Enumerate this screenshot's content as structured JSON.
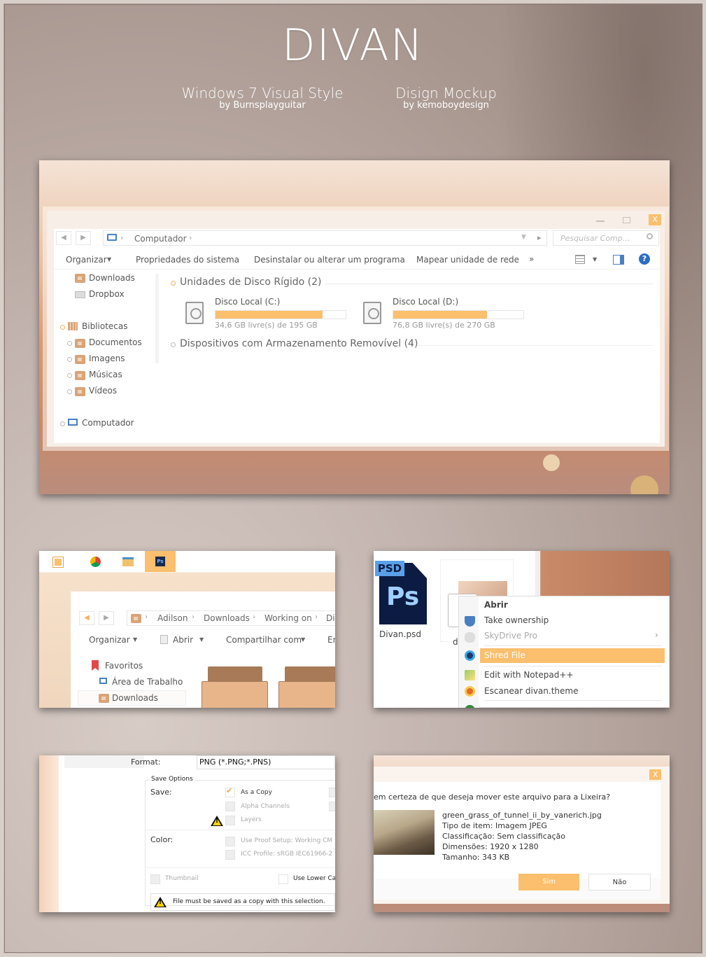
{
  "header": {
    "title": "DIVAN",
    "credit1": {
      "line1": "Windows 7 Visual Style",
      "line2": "by Burnsplayguitar"
    },
    "credit2": {
      "line1": "Disign Mockup",
      "line2": "by kemoboydesign"
    }
  },
  "explorer": {
    "address": "Computador",
    "search_placeholder": "Pesquisar Comp...",
    "toolbar": [
      "Organizar",
      "Propriedades do sistema",
      "Desinstalar ou alterar um programa",
      "Mapear unidade de rede"
    ],
    "more": "»",
    "sidebar": {
      "favorites": [
        "Downloads",
        "Dropbox"
      ],
      "libraries": "Bibliotecas",
      "library_items": [
        "Documentos",
        "Imagens",
        "Músicas",
        "Vídeos"
      ],
      "computer": "Computador"
    },
    "group1": "Unidades de Disco Rígido (2)",
    "drives": [
      {
        "name": "Disco Local (C:)",
        "free": "34,6 GB livre(s) de 195 GB",
        "used": 0.82
      },
      {
        "name": "Disco Local (D:)",
        "free": "76,8 GB livre(s) de 270 GB",
        "used": 0.72
      }
    ],
    "group2": "Dispositivos com Armazenamento Removível (4)"
  },
  "taskbar_panel": {
    "breadcrumb": [
      "Adilson",
      "Downloads",
      "Working on",
      "Di"
    ],
    "toolbar": [
      "Organizar",
      "Abrir",
      "Compartilhar com",
      "Er"
    ],
    "sidebar": [
      "Favoritos",
      "Área de Trabalho",
      "Downloads"
    ]
  },
  "context_panel": {
    "file_label": "Divan.psd",
    "psd_tag": "PSD",
    "ps_text": "Ps",
    "second_label": "di",
    "menu": [
      {
        "label": "Abrir",
        "bold": true
      },
      {
        "label": "Take ownership"
      },
      {
        "label": "SkyDrive Pro",
        "disabled": true,
        "arrow": "›"
      },
      {
        "label": "Shred File",
        "highlight": true
      },
      {
        "label": "Edit with Notepad++"
      },
      {
        "label": "Escanear divan.theme"
      }
    ]
  },
  "save_panel": {
    "format_label": "Format:",
    "format_value": "PNG (*.PNG;*.PNS)",
    "group": "Save Options",
    "save_label": "Save:",
    "options": [
      "As a Copy",
      "Alpha Channels",
      "Layers"
    ],
    "color_label": "Color:",
    "color_options": [
      "Use Proof Setup:  Working CM",
      "ICC Profile:  sRGB IEC61966-2"
    ],
    "thumbnail": "Thumbnail",
    "lower": "Use Lower Ca",
    "warning": "File must be saved as a copy with this selection."
  },
  "delete_panel": {
    "question": "em certeza de que deseja mover este arquivo para a Lixeira?",
    "filename": "green_grass_of_tunnel_ii_by_vanerich.jpg",
    "type": "Tipo de item: Imagem JPEG",
    "rating": "Classificação: Sem classificação",
    "dimensions": "Dimensões: 1920 x 1280",
    "size": "Tamanho: 343 KB",
    "yes": "Sim",
    "no": "Não",
    "close": "X"
  },
  "colors": {
    "accent": "#fbbf6d",
    "folder": "#d8a47a"
  }
}
